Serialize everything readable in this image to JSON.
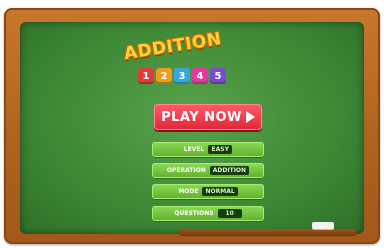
{
  "game": {
    "title": "ADDITION",
    "title_blocks": [
      "1",
      "2",
      "3",
      "4",
      "5"
    ],
    "block_colors": [
      "#e23b3b",
      "#f29a1b",
      "#33a8e0",
      "#e03aa0",
      "#7a4bd1"
    ],
    "play_button": {
      "label": "PLAY NOW",
      "icon": "play-triangle-icon"
    },
    "menu": [
      {
        "label": "LEVEL",
        "value": "EASY"
      },
      {
        "label": "OPERATION",
        "value": "ADDITION"
      },
      {
        "label": "MODE",
        "value": "NORMAL"
      },
      {
        "label": "QUESTIONS",
        "value": "10"
      }
    ]
  }
}
